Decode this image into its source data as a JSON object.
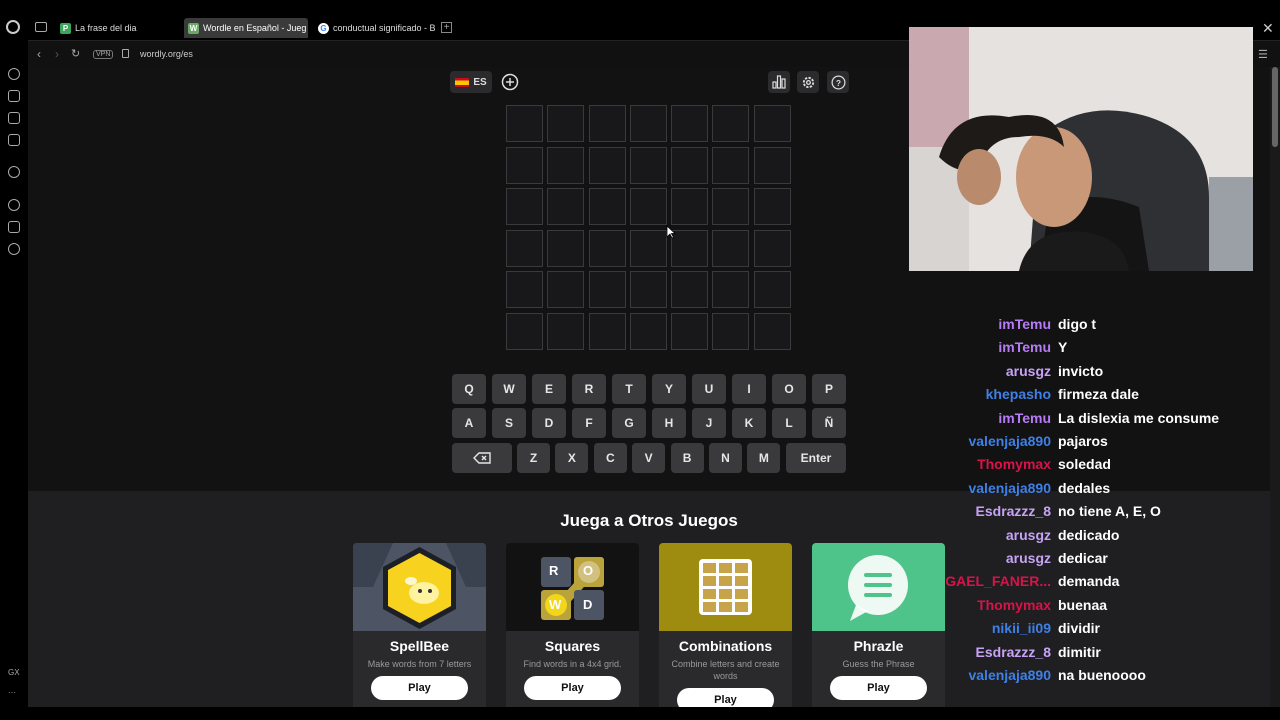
{
  "browser": {
    "tabs": [
      {
        "label": "La frase del dia",
        "favicon_letter": "P",
        "favicon_color": "#3ba55c",
        "active": false
      },
      {
        "label": "Wordle en Español - Jueg",
        "favicon_letter": "W",
        "favicon_color": "#6aaa64",
        "active": true
      },
      {
        "label": "conductual significado - B",
        "favicon_letter": "G",
        "favicon_color": "#4285f4",
        "active": false
      }
    ],
    "new_tab": "+",
    "url": "wordly.org/es",
    "vpn_label": "VPN",
    "sidebar_bottom_label": "GX",
    "sidebar_more": "···"
  },
  "header": {
    "language": "ES"
  },
  "board": {
    "rows": 6,
    "cols": 7
  },
  "keyboard": {
    "row1": [
      "Q",
      "W",
      "E",
      "R",
      "T",
      "Y",
      "U",
      "I",
      "O",
      "P"
    ],
    "row2": [
      "A",
      "S",
      "D",
      "F",
      "G",
      "H",
      "J",
      "K",
      "L",
      "Ñ"
    ],
    "row3": [
      "Z",
      "X",
      "C",
      "V",
      "B",
      "N",
      "M"
    ],
    "enter": "Enter"
  },
  "games": {
    "title": "Juega a Otros Juegos",
    "cards": [
      {
        "name": "SpellBee",
        "desc": "Make words from 7 letters",
        "play": "Play",
        "bg": "#4d5565"
      },
      {
        "name": "Squares",
        "desc": "Find words in a 4x4 grid.",
        "play": "Play",
        "bg": "#121212",
        "tiles": [
          "R",
          "O",
          "W",
          "D"
        ]
      },
      {
        "name": "Combinations",
        "desc": "Combine letters and create words",
        "play": "Play",
        "bg": "#9e8c10"
      },
      {
        "name": "Phrazle",
        "desc": "Guess the Phrase",
        "play": "Play",
        "bg": "#4fc48a"
      }
    ]
  },
  "chat": [
    {
      "user": "imTemu",
      "color": "#b57cf4",
      "msg": "digo t"
    },
    {
      "user": "imTemu",
      "color": "#b57cf4",
      "msg": "Y"
    },
    {
      "user": "arusgz",
      "color": "#c6a3f5",
      "msg": "invicto"
    },
    {
      "user": "khepasho",
      "color": "#3f80e6",
      "msg": "firmeza dale"
    },
    {
      "user": "imTemu",
      "color": "#b57cf4",
      "msg": "La dislexia me consume"
    },
    {
      "user": "valenjaja890",
      "color": "#3f80e6",
      "msg": "pajaros"
    },
    {
      "user": "Thomymax",
      "color": "#d8134a",
      "msg": "soledad"
    },
    {
      "user": "valenjaja890",
      "color": "#3f80e6",
      "msg": "dedales"
    },
    {
      "user": "Esdrazzz_8",
      "color": "#c6a3f5",
      "msg": "no tiene A, E, O"
    },
    {
      "user": "arusgz",
      "color": "#c6a3f5",
      "msg": "dedicado"
    },
    {
      "user": "arusgz",
      "color": "#c6a3f5",
      "msg": "dedicar"
    },
    {
      "user": "GAEL_FANER...",
      "color": "#d8134a",
      "msg": "demanda"
    },
    {
      "user": "Thomymax",
      "color": "#d8134a",
      "msg": "buenaa"
    },
    {
      "user": "nikii_ii09",
      "color": "#3f80e6",
      "msg": "dividir"
    },
    {
      "user": "Esdrazzz_8",
      "color": "#c6a3f5",
      "msg": "dimitir"
    },
    {
      "user": "valenjaja890",
      "color": "#3f80e6",
      "msg": "na buenoooo"
    }
  ]
}
